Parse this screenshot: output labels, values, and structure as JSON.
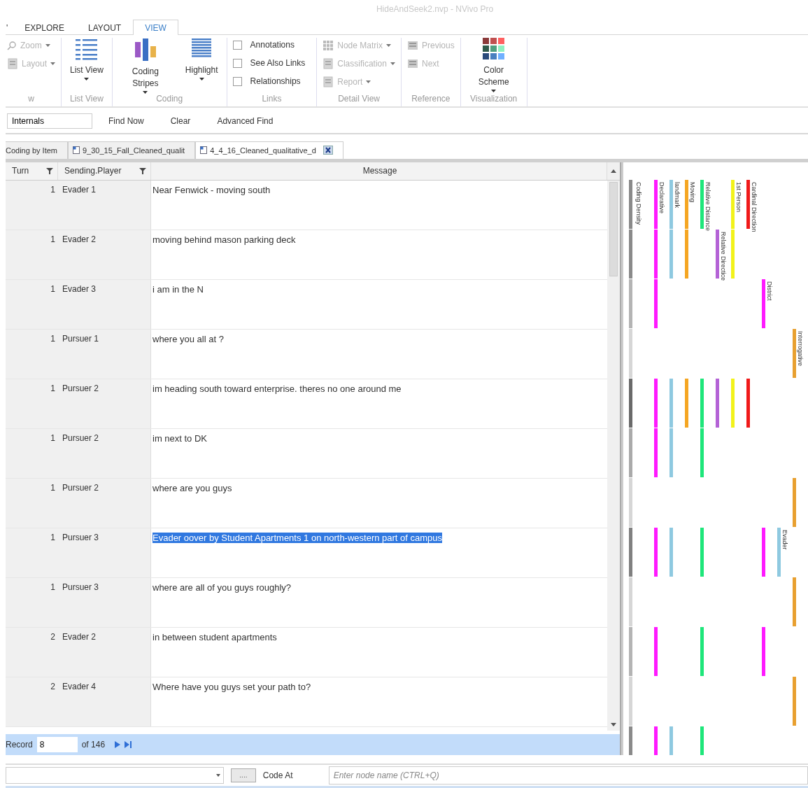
{
  "window": {
    "title": "HideAndSeek2.nvp - NVivo Pro"
  },
  "ribbon": {
    "tabs": [
      {
        "label": "'",
        "selected": false
      },
      {
        "label": "EXPLORE",
        "selected": false
      },
      {
        "label": "LAYOUT",
        "selected": false
      },
      {
        "label": "VIEW",
        "selected": true
      }
    ],
    "groups": [
      {
        "kind": "small",
        "label": "w",
        "items": [
          {
            "label": "Zoom",
            "dropdown": true,
            "disabled": true
          },
          {
            "label": "Layout",
            "dropdown": true,
            "disabled": true
          }
        ]
      },
      {
        "kind": "large",
        "label": "List View",
        "items": [
          {
            "label": "List View",
            "dropdown": true,
            "disabled": false
          }
        ]
      },
      {
        "kind": "large",
        "label": "Coding",
        "items": [
          {
            "label": "Coding Stripes",
            "dropdown": true,
            "disabled": false
          },
          {
            "label": "Highlight",
            "dropdown": true,
            "disabled": false
          }
        ]
      },
      {
        "kind": "checks",
        "label": "Links",
        "items": [
          {
            "label": "Annotations",
            "checked": false
          },
          {
            "label": "See Also Links",
            "checked": false
          },
          {
            "label": "Relationships",
            "checked": false
          }
        ]
      },
      {
        "kind": "small",
        "label": "Detail View",
        "items": [
          {
            "label": "Node Matrix",
            "dropdown": true,
            "disabled": true
          },
          {
            "label": "Classification",
            "dropdown": true,
            "disabled": true
          },
          {
            "label": "Report",
            "dropdown": true,
            "disabled": true
          }
        ]
      },
      {
        "kind": "small",
        "label": "Reference",
        "items": [
          {
            "label": "Previous",
            "disabled": true
          },
          {
            "label": "Next",
            "disabled": true
          }
        ]
      },
      {
        "kind": "large",
        "label": "Visualization",
        "items": [
          {
            "label": "Color Scheme",
            "dropdown": true,
            "disabled": false
          }
        ]
      }
    ]
  },
  "find_bar": {
    "value": "Internals",
    "buttons": [
      "Find Now",
      "Clear",
      "Advanced Find"
    ]
  },
  "doc_tabs": [
    {
      "label": "Coding by Item",
      "selected": false
    },
    {
      "label": "9_30_15_Fall_Cleaned_qualit",
      "selected": false
    },
    {
      "label": "4_4_16_Cleaned_qualitative_d",
      "selected": true,
      "closable": true
    }
  ],
  "table": {
    "columns": [
      {
        "label": "Turn",
        "filter": true
      },
      {
        "label": "Sending.Player",
        "filter": true
      },
      {
        "label": "Message"
      }
    ],
    "rows": [
      {
        "turn": "1",
        "player": "Evader 1",
        "message": "Near Fenwick - moving south",
        "selected": false
      },
      {
        "turn": "1",
        "player": "Evader 2",
        "message": "moving behind mason parking deck",
        "selected": false
      },
      {
        "turn": "1",
        "player": "Evader 3",
        "message": "i am in the N",
        "selected": false
      },
      {
        "turn": "1",
        "player": "Pursuer 1",
        "message": "where you all at ?",
        "selected": false
      },
      {
        "turn": "1",
        "player": "Pursuer 2",
        "message": "im heading south toward enterprise. theres no one around me",
        "selected": false
      },
      {
        "turn": "1",
        "player": "Pursuer 2",
        "message": "im next to DK",
        "selected": false
      },
      {
        "turn": "1",
        "player": "Pursuer 2",
        "message": "where are you guys",
        "selected": false
      },
      {
        "turn": "1",
        "player": "Pursuer 3",
        "message": "Evader oover by Student Apartments 1 on north-western part of campus",
        "selected": true
      },
      {
        "turn": "1",
        "player": "Pursuer 3",
        "message": "where are all of you guys roughly?",
        "selected": false
      },
      {
        "turn": "2",
        "player": "Evader 2",
        "message": "in between student apartments",
        "selected": false
      },
      {
        "turn": "2",
        "player": "Evader 4",
        "message": "Where have you guys set your path to?",
        "selected": false
      }
    ]
  },
  "record_bar": {
    "label": "Record",
    "value": "8",
    "total": "of 146"
  },
  "coding_stripes": {
    "density": {
      "label": "Coding Density",
      "segments": [
        {
          "color": "#8a8a8a"
        },
        {
          "color": "#8a8a8a"
        },
        {
          "color": "#b4b4b4"
        },
        {
          "color": "#d6d6d6"
        },
        {
          "color": "#6a6a6a"
        },
        {
          "color": "#aaaaaa"
        },
        {
          "color": "#d6d6d6"
        },
        {
          "color": "#808080"
        },
        {
          "color": "#d6d6d6"
        },
        {
          "color": "#b4b4b4"
        },
        {
          "color": "#d6d6d6"
        },
        {
          "color": "#8a8a8a"
        }
      ]
    },
    "stripes": [
      {
        "name": "Declarative",
        "color": "#ff1aff",
        "spans": [
          true,
          true,
          true,
          false,
          true,
          true,
          false,
          true,
          false,
          true,
          false,
          true
        ]
      },
      {
        "name": "landmark",
        "color": "#8ec9e0",
        "spans": [
          true,
          true,
          false,
          false,
          true,
          true,
          false,
          true,
          false,
          false,
          false,
          true
        ]
      },
      {
        "name": "Moving",
        "color": "#f5a623",
        "spans": [
          true,
          true,
          false,
          false,
          true,
          false,
          false,
          false,
          false,
          false,
          false,
          false
        ]
      },
      {
        "name": "Relative Distance",
        "color": "#1ee67a",
        "spans": [
          true,
          false,
          false,
          false,
          true,
          true,
          false,
          true,
          false,
          true,
          false,
          true
        ]
      },
      {
        "name": "Relative Directice",
        "color": "#b463d6",
        "spans": [
          false,
          true,
          false,
          false,
          true,
          false,
          false,
          false,
          false,
          false,
          false,
          false
        ]
      },
      {
        "name": "1st Person",
        "color": "#f2f21a",
        "spans": [
          true,
          true,
          false,
          false,
          true,
          false,
          false,
          false,
          false,
          false,
          false,
          false
        ]
      },
      {
        "name": "Cardinal Direction",
        "color": "#f01a1a",
        "spans": [
          true,
          false,
          false,
          false,
          true,
          false,
          false,
          false,
          false,
          false,
          false,
          false
        ]
      },
      {
        "name": "District",
        "color": "#ff1aff",
        "spans": [
          false,
          false,
          true,
          false,
          false,
          false,
          false,
          true,
          false,
          true,
          false,
          false
        ]
      },
      {
        "name": "Evader",
        "color": "#8ec9e0",
        "spans": [
          false,
          false,
          false,
          false,
          false,
          false,
          false,
          true,
          false,
          false,
          false,
          false
        ]
      },
      {
        "name": "Interrogative",
        "color": "#e8a030",
        "spans": [
          false,
          false,
          false,
          true,
          false,
          false,
          true,
          false,
          true,
          false,
          true,
          false
        ]
      }
    ]
  },
  "code_bar": {
    "button": "....",
    "label": "Code At",
    "placeholder": "Enter node name (CTRL+Q)"
  }
}
